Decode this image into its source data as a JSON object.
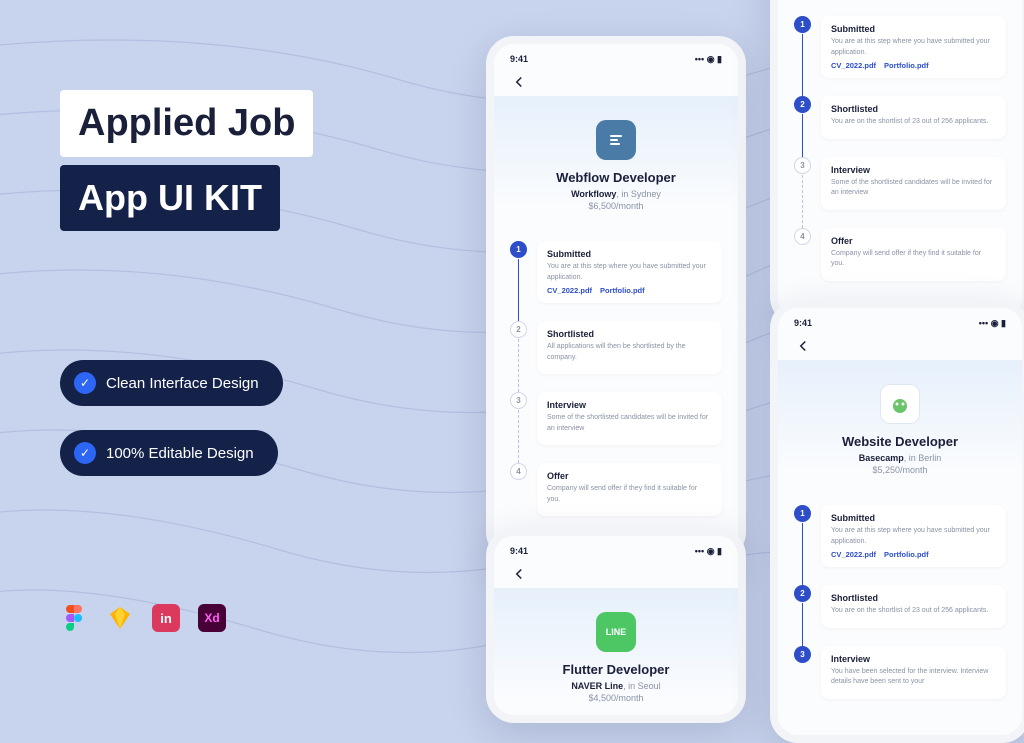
{
  "marketing": {
    "title_line1": "Applied Job",
    "title_line2": "App UI KIT",
    "pill1": "Clean Interface Design",
    "pill2": "100% Editable Design",
    "tools": [
      "figma",
      "sketch",
      "invision",
      "xd"
    ]
  },
  "status_time": "9:41",
  "phones": {
    "p1": {
      "job_title": "Webflow Developer",
      "company": "Workflowy",
      "location": ", in Sydney",
      "salary": "$6,500/month",
      "steps": [
        {
          "n": "1",
          "active": true,
          "title": "Submitted",
          "desc": "You are at this step where you have submitted your application.",
          "files": [
            "CV_2022.pdf",
            "Portfolio.pdf"
          ]
        },
        {
          "n": "2",
          "active": false,
          "title": "Shortlisted",
          "desc": "All applications will then be shortlisted by the company."
        },
        {
          "n": "3",
          "active": false,
          "title": "Interview",
          "desc": "Some of the shortlisted candidates will be invited for an interview"
        },
        {
          "n": "4",
          "active": false,
          "title": "Offer",
          "desc": "Company will send offer if they find it suitable for you."
        }
      ]
    },
    "p2": {
      "steps": [
        {
          "n": "1",
          "active": true,
          "title": "Submitted",
          "desc": "You are at this step where you have submitted your application.",
          "files": [
            "CV_2022.pdf",
            "Portfolio.pdf"
          ]
        },
        {
          "n": "2",
          "active": true,
          "title": "Shortlisted",
          "desc": "You are on the shortlist of 23 out of 256 applicants."
        },
        {
          "n": "3",
          "active": false,
          "title": "Interview",
          "desc": "Some of the shortlisted candidates will be invited for an interview"
        },
        {
          "n": "4",
          "active": false,
          "title": "Offer",
          "desc": "Company will send offer if they find it suitable for you."
        }
      ]
    },
    "p3": {
      "job_title": "Flutter Developer",
      "company": "NAVER Line",
      "location": ", in Seoul",
      "salary": "$4,500/month"
    },
    "p4": {
      "job_title": "Website Developer",
      "company": "Basecamp",
      "location": ", in Berlin",
      "salary": "$5,250/month",
      "steps": [
        {
          "n": "1",
          "active": true,
          "title": "Submitted",
          "desc": "You are at this step where you have submitted your application.",
          "files": [
            "CV_2022.pdf",
            "Portfolio.pdf"
          ]
        },
        {
          "n": "2",
          "active": true,
          "title": "Shortlisted",
          "desc": "You are on the shortlist of 23 out of 256 applicants."
        },
        {
          "n": "3",
          "active": true,
          "title": "Interview",
          "desc": "You have been selected for the interview. Interview details have been sent to your"
        }
      ]
    }
  }
}
